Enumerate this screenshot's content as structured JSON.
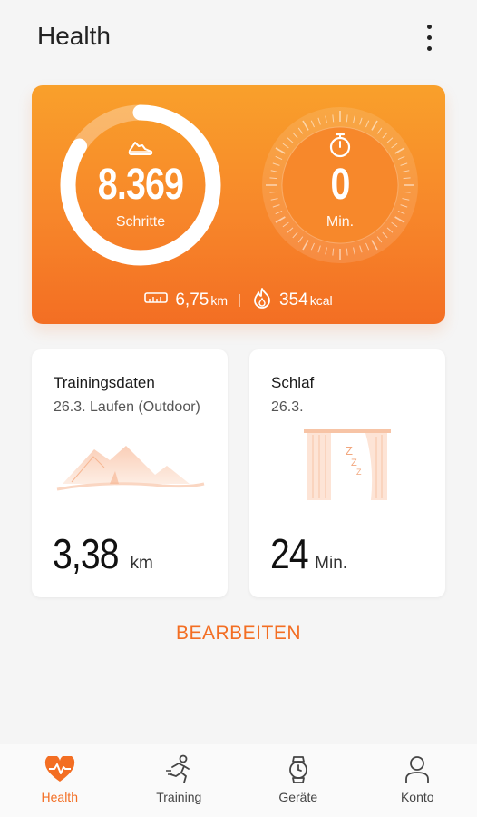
{
  "header": {
    "title": "Health",
    "menu_icon": "more-vert-icon"
  },
  "summary": {
    "steps": {
      "value": "8.369",
      "label": "Schritte",
      "icon": "shoe-icon",
      "progress": 0.84
    },
    "active_time": {
      "value": "0",
      "label": "Min.",
      "icon": "stopwatch-icon"
    },
    "distance": {
      "value": "6,75",
      "unit": "km",
      "icon": "ruler-icon"
    },
    "calories": {
      "value": "354",
      "unit": "kcal",
      "icon": "flame-icon"
    },
    "colors": {
      "gradient_top": "#f9a02b",
      "gradient_bottom": "#f36e23"
    }
  },
  "cards": {
    "training": {
      "title": "Trainingsdaten",
      "subtitle": "26.3. Laufen (Outdoor)",
      "value": "3,38",
      "unit": "km",
      "illustration": "mountains-icon"
    },
    "sleep": {
      "title": "Schlaf",
      "subtitle": "26.3.",
      "value": "24",
      "unit": "Min.",
      "illustration": "curtain-sleep-icon"
    }
  },
  "edit_label": "BEARBEITEN",
  "nav": {
    "items": [
      {
        "label": "Health",
        "icon": "heart-pulse-icon",
        "active": true
      },
      {
        "label": "Training",
        "icon": "runner-icon",
        "active": false
      },
      {
        "label": "Geräte",
        "icon": "watch-icon",
        "active": false
      },
      {
        "label": "Konto",
        "icon": "person-icon",
        "active": false
      }
    ]
  },
  "accent_color": "#f36e23"
}
